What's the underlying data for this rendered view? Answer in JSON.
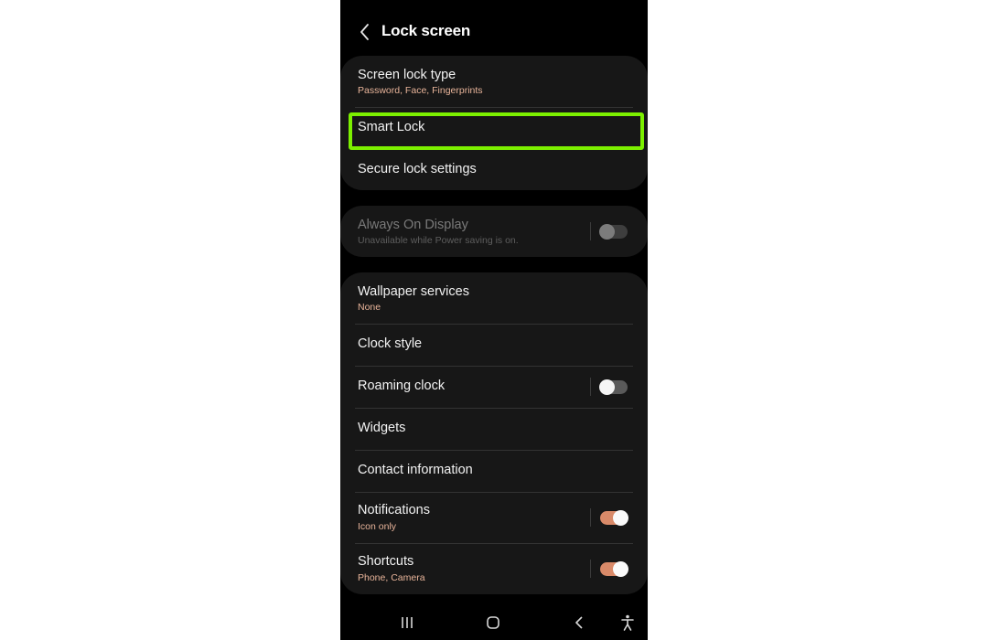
{
  "header": {
    "title": "Lock screen",
    "back_icon": "chevron-left-icon"
  },
  "security_group": [
    {
      "label": "Screen lock type",
      "sub": "Password, Face, Fingerprints"
    },
    {
      "label": "Smart Lock",
      "highlighted": true
    },
    {
      "label": "Secure lock settings"
    }
  ],
  "aod": {
    "label": "Always On Display",
    "sub": "Unavailable while Power saving is on.",
    "toggle": "off",
    "disabled": true
  },
  "customize_group": [
    {
      "label": "Wallpaper services",
      "sub": "None"
    },
    {
      "label": "Clock style"
    },
    {
      "label": "Roaming clock",
      "toggle": "off"
    },
    {
      "label": "Widgets"
    },
    {
      "label": "Contact information"
    },
    {
      "label": "Notifications",
      "sub": "Icon only",
      "toggle": "on"
    },
    {
      "label": "Shortcuts",
      "sub": "Phone, Camera",
      "toggle": "on"
    }
  ],
  "navbar": {
    "recents_icon": "recents-icon",
    "home_icon": "home-icon",
    "back_icon": "back-icon",
    "accessibility_icon": "accessibility-icon"
  },
  "colors": {
    "accent_sub": "#e8b49a",
    "toggle_on": "#d98a69",
    "highlight": "#7cf000",
    "card_bg": "#171717"
  }
}
